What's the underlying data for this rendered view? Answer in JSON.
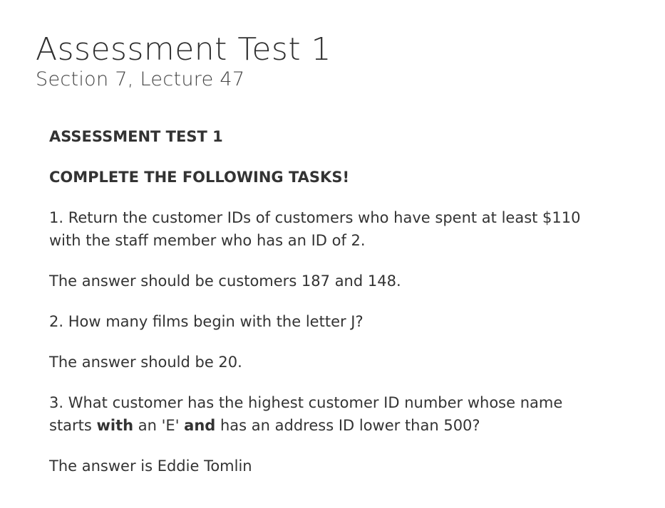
{
  "header": {
    "title": "Assessment Test 1",
    "subtitle": "Section 7, Lecture 47"
  },
  "content": {
    "heading_1": "ASSESSMENT TEST 1",
    "heading_2": "COMPLETE THE FOLLOWING TASKS!",
    "task_1": {
      "question": "1. Return the customer IDs of customers who have spent at least $110 with the staff member who has an ID of 2.",
      "answer": "The answer should be customers 187 and 148."
    },
    "task_2": {
      "question": "2. How many films begin with the letter J?",
      "answer": "The answer should be 20."
    },
    "task_3": {
      "question_part_1": "3. What customer has the highest customer ID number whose name starts ",
      "question_bold_1": "with",
      "question_part_2": " an 'E' ",
      "question_bold_2": "and",
      "question_part_3": " has an address ID lower than 500?",
      "answer": "The answer is Eddie Tomlin"
    }
  }
}
